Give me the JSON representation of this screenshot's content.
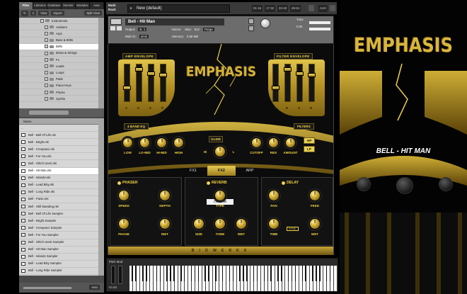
{
  "browser": {
    "tabs": [
      "Files",
      "Libraries",
      "Database",
      "Monitor",
      "Modules",
      "Auto"
    ],
    "toolbar": {
      "view": "View",
      "import": "Import",
      "split": "Split View"
    },
    "tree_top": "Instruments",
    "tree": [
      "Ambient",
      "Arps",
      "Bass & 808s",
      "Bells",
      "Brass & Strings",
      "Fx",
      "Leads",
      "Loops",
      "Pads",
      "Piano Keys",
      "Plucks",
      "Synths"
    ],
    "tree_selected_index": 3,
    "files_header": "Name",
    "files_top": "..",
    "files": [
      "Bell - Bell Of Life.nki",
      "Bell - Bright.nki",
      "Bell - Crespanci.nki",
      "Bell - For You.nki",
      "Bell - Glitch Uterti.nki",
      "Bell - Hit Man.nki",
      "Bell - Islands.nki",
      "Bell - Lead Blsy.nki",
      "Bell - Long Ride.nki",
      "Bell - Pulse.nki",
      "Bell - Still Standing.nki",
      "Bell - Bell Of Life Sampler",
      "Bell - Bright Sampler",
      "Bell - Crespanci Sampler",
      "Bell - For You Sampler",
      "Bell - Glitch Uterti Sampler",
      "Bell - Hit Man Sampler",
      "Bell - Islands Sampler",
      "Bell - Lead Blsy Sampler",
      "Bell - Long Ride Sampler"
    ],
    "files_selected_index": 5,
    "bottom_btn": "Auto"
  },
  "topbar": {
    "rack": "Multi\nRack",
    "preset": "New (default)",
    "cells": [
      "01-16",
      "17-32",
      "33-48",
      "49-64"
    ],
    "aux": "AUX"
  },
  "instrument": {
    "name": "Bell - Hit Man",
    "output_label": "Output:",
    "output_value": "st. 1",
    "voices_label": "Voices:",
    "voices_max_label": "Max:",
    "voices_max": "512",
    "purge": "Purge",
    "midi_label": "Midi Ch:",
    "midi_value": "omni",
    "memory_label": "Memory:",
    "memory_value": "0.58 MB",
    "tune_label": "Tune",
    "tune_value": "0.00"
  },
  "panel": {
    "logo": "EMPHASIS",
    "amp_env": "AMP ENVELOPE",
    "filter_env": "FILTER ENVELOPE",
    "adsr": [
      "A",
      "D",
      "S",
      "R"
    ],
    "band_eq": "4 BAND EQ",
    "eq_knobs": [
      "LOW",
      "LO-MID",
      "HI-MID",
      "HIGH"
    ],
    "glide": "GLIDE",
    "glide_m": "M",
    "glide_l": "L",
    "filters": "FILTERS",
    "filter_knobs": [
      "CUTOFF",
      "RES",
      "AMOUNT"
    ],
    "hp": "HP",
    "lp": "LP",
    "tabs": [
      "FX1",
      "FX2",
      "ARP"
    ],
    "phaser": "PHASER",
    "phaser_knobs": [
      "SPEED",
      "DEPTH",
      "PHASE",
      "WET"
    ],
    "reverb": "REVERB",
    "reverb_room": "Conc Hall",
    "reverb_knobs": [
      "TYPE",
      "SIZE",
      "TONE",
      "WET"
    ],
    "delay": "DELAY",
    "delay_knobs": [
      "PAN",
      "FEED",
      "TIME",
      "WET"
    ],
    "sync": "SYNC",
    "footer": "BIOWERKS"
  },
  "keyboard": {
    "title": "Pitch Mod",
    "oct": "+2 oct"
  },
  "art": {
    "logo": "EMPHASIS",
    "title": "BELL - HIT MAN"
  },
  "colors": {
    "gold": "#d5b33a",
    "accent": "#f2d342"
  }
}
